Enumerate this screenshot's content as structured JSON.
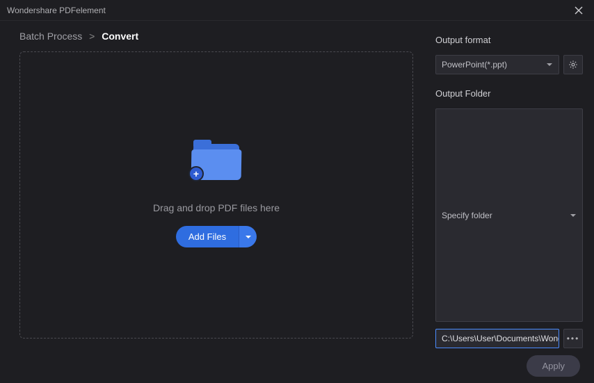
{
  "titlebar": {
    "app_title": "Wondershare PDFelement"
  },
  "breadcrumb": {
    "root": "Batch Process",
    "separator": ">",
    "current": "Convert"
  },
  "dropzone": {
    "hint": "Drag and drop PDF files here",
    "add_files_label": "Add Files"
  },
  "right": {
    "output_format_label": "Output format",
    "output_format_value": "PowerPoint(*.ppt)",
    "output_folder_label": "Output Folder",
    "folder_mode_value": "Specify folder",
    "folder_path_value": "C:\\Users\\User\\Documents\\Wondershare"
  },
  "footer": {
    "apply_label": "Apply"
  }
}
